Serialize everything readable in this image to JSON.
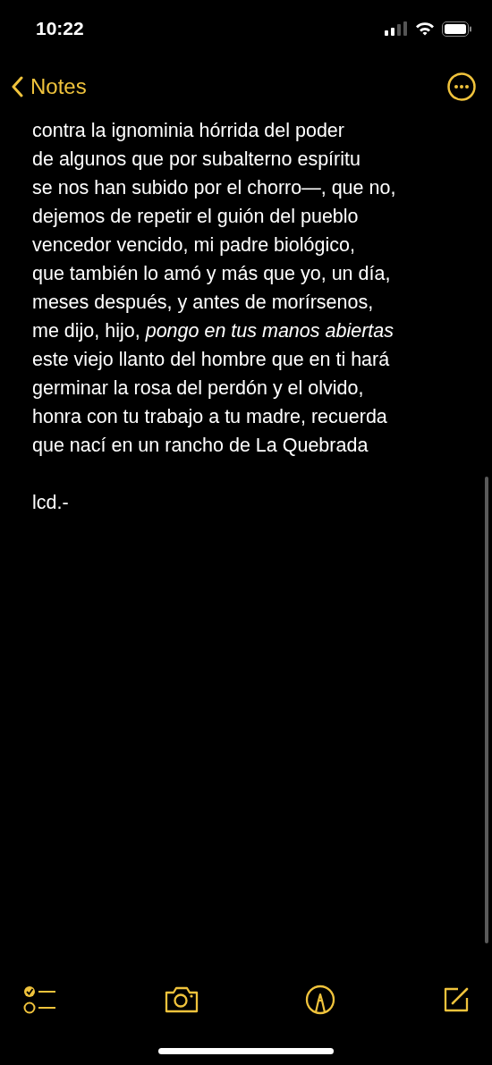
{
  "status_bar": {
    "time": "10:22"
  },
  "nav": {
    "back_label": "Notes"
  },
  "note": {
    "lines": [
      "contra la ignominia hórrida del poder",
      "de algunos que por subalterno espíritu",
      "se nos han subido por el chorro—, que no,",
      "dejemos de repetir el guión del pueblo",
      "vencedor vencido, mi padre biológico,",
      "que también lo amó y más que yo, un día,",
      "meses después, y antes de morírsenos,",
      "me dijo, hijo, *pongo en tus manos abiertas*",
      "este viejo llanto del hombre que en ti hará",
      "germinar la rosa del perdón y el olvido,",
      "honra con tu trabajo a tu madre, recuerda",
      "que nací en un rancho de La Quebrada"
    ],
    "signature": "lcd.-"
  }
}
